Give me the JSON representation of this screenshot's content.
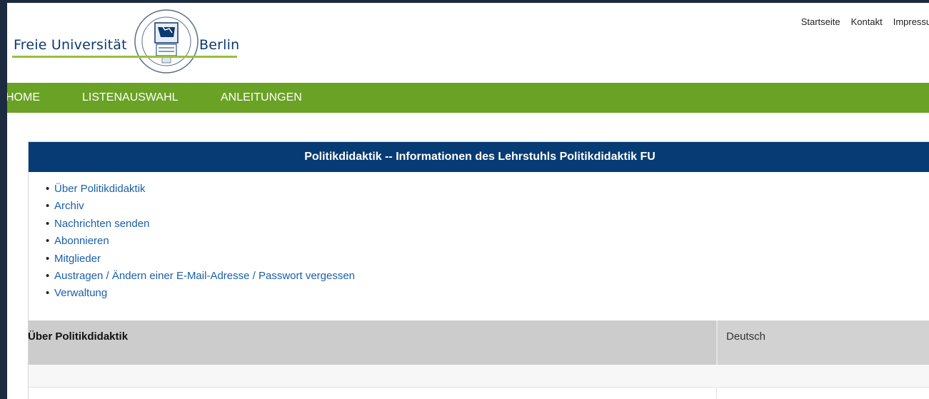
{
  "header": {
    "logo_left": "Freie Universität",
    "logo_right": "Berlin",
    "top_links": [
      "Startseite",
      "Kontakt",
      "Impressum"
    ]
  },
  "nav": {
    "items": [
      "HOME",
      "LISTENAUSWAHL",
      "ANLEITUNGEN"
    ]
  },
  "list": {
    "title": "Politikdidaktik -- Informationen des Lehrstuhls Politikdidaktik FU",
    "links": [
      "Über Politikdidaktik",
      "Archiv",
      "Nachrichten senden",
      "Abonnieren",
      "Mitglieder",
      "Austragen / Ändern einer E-Mail-Adresse / Passwort vergessen",
      "Verwaltung"
    ]
  },
  "info": {
    "heading": "Über Politikdidaktik",
    "language": "Deutsch"
  },
  "colors": {
    "page_bg": "#1c2b3f",
    "nav_green": "#6aa225",
    "title_blue": "#073b73",
    "link_blue": "#1a5fa8"
  }
}
